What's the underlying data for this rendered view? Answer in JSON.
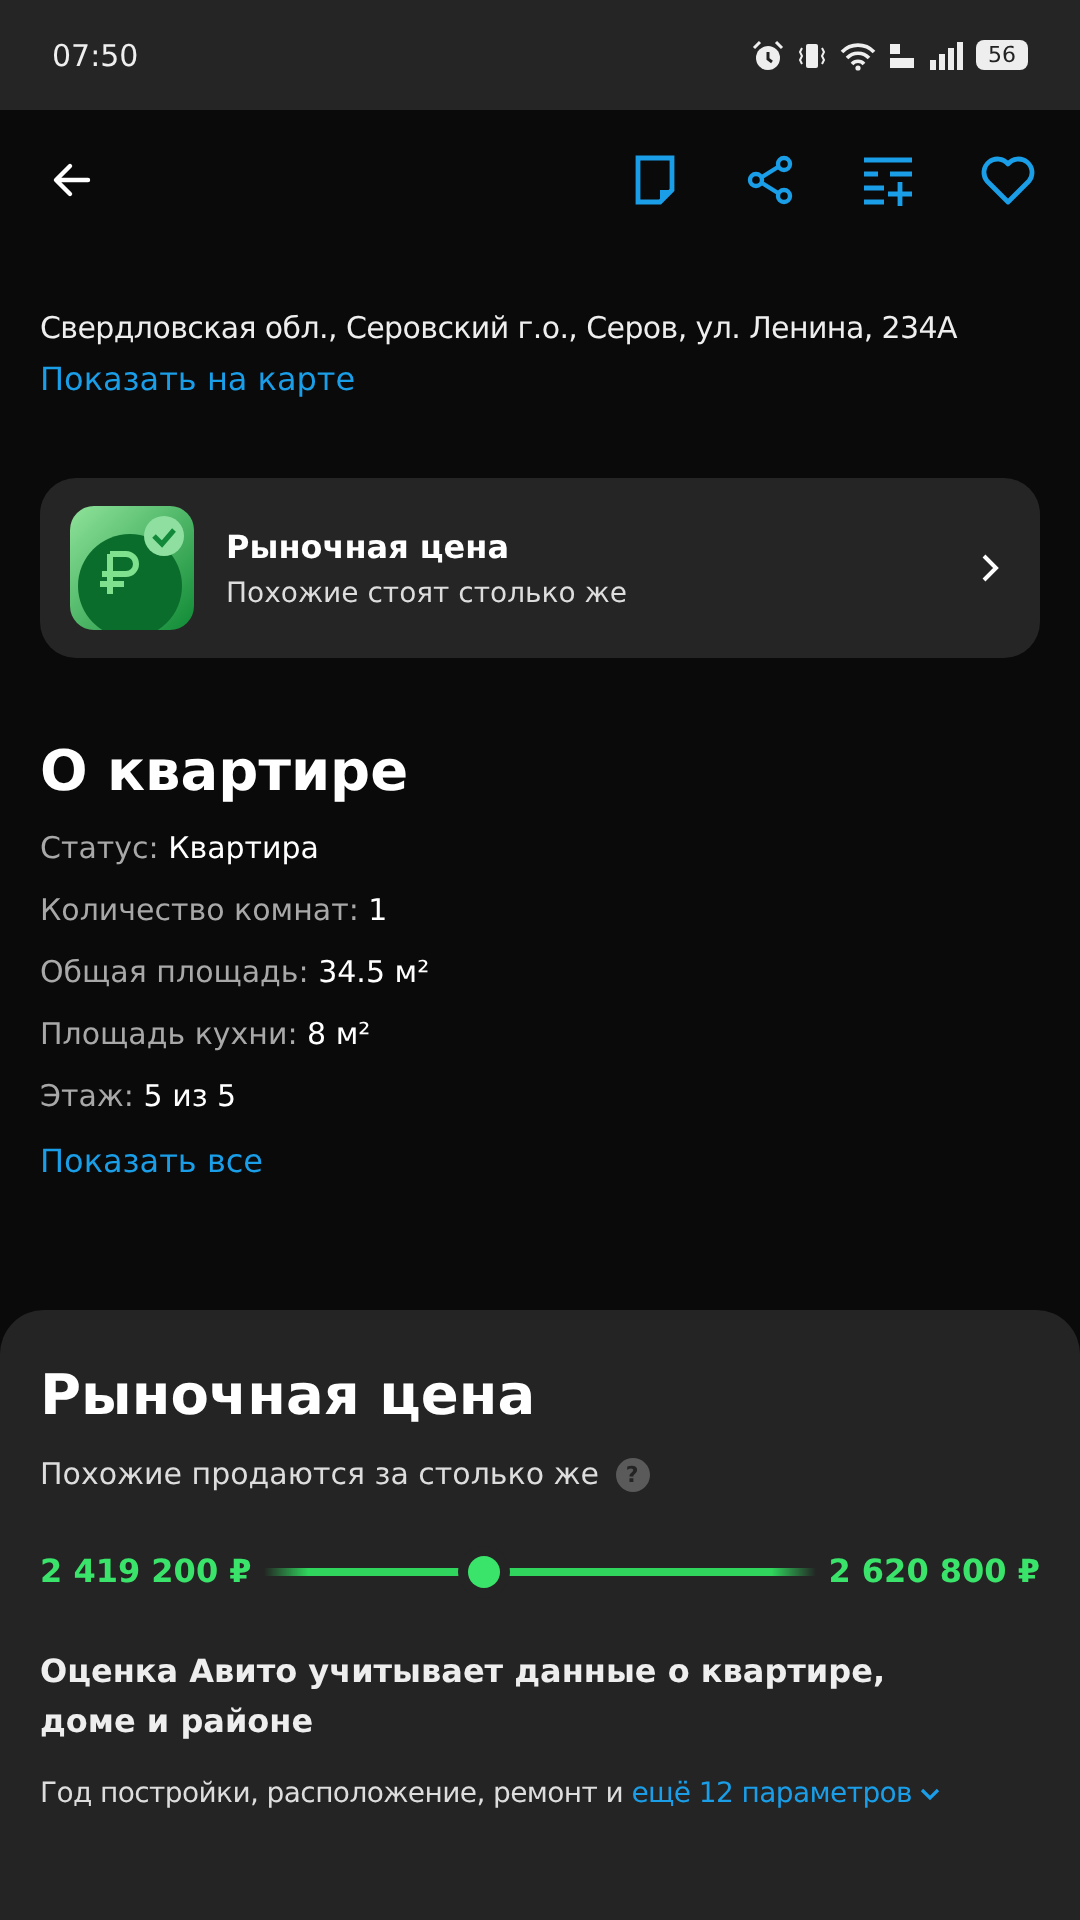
{
  "status_bar": {
    "time": "07:50",
    "battery": "56"
  },
  "address": {
    "text": "Свердловская обл., Серовский г.о., Серов, ул. Ленина, 234А",
    "link": "Показать на карте"
  },
  "market_card": {
    "title": "Рыночная цена",
    "subtitle": "Похожие стоят столько же"
  },
  "about": {
    "title": "О квартире",
    "params": [
      {
        "label": "Статус:",
        "value": "Квартира"
      },
      {
        "label": "Количество комнат:",
        "value": "1"
      },
      {
        "label": "Общая площадь:",
        "value": "34.5 м²"
      },
      {
        "label": "Площадь кухни:",
        "value": "8 м²"
      },
      {
        "label": "Этаж:",
        "value": "5 из 5"
      }
    ],
    "show_all": "Показать все"
  },
  "market_sheet": {
    "title": "Рыночная цена",
    "subtitle": "Похожие продаются за столько же",
    "help": "?",
    "min": "2 419 200 ₽",
    "max": "2 620 800 ₽",
    "level": 0.4,
    "heading": "Оценка Авито учитывает данные о квартире, доме и районе",
    "note": "Год постройки, расположение, ремонт и ",
    "note_link": "ещё 12 параметров"
  }
}
